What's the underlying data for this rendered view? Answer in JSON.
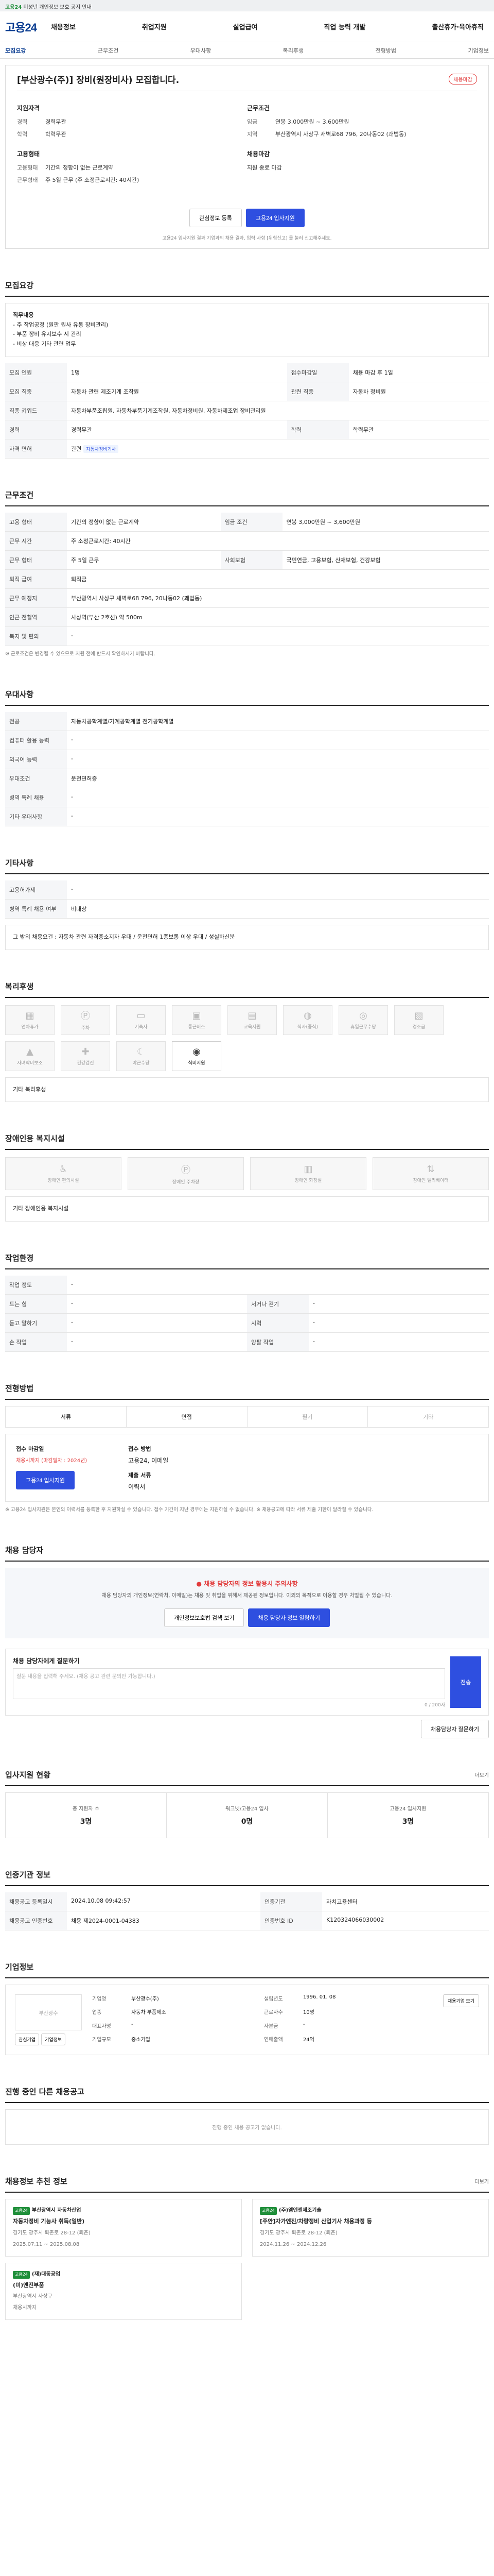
{
  "topbar": {
    "notice_prefix": "고용24",
    "notice_text": "미성년 개인정보 보호 공지 안내"
  },
  "header": {
    "logo": "고용24",
    "nav": [
      "채용정보",
      "취업지원",
      "실업급여",
      "직업 능력 개발",
      "출산휴가·육아휴직"
    ]
  },
  "subnav": {
    "items": [
      "모집요강",
      "근무조건",
      "우대사항",
      "복리후생",
      "전형방법",
      "기업정보"
    ],
    "active": 0
  },
  "job": {
    "title": "[부산광수(주)] 장비(원장비사) 모집합니다.",
    "badge": "채용마감",
    "left_title": "지원자격",
    "left": [
      {
        "k": "경력",
        "v": "경력무관"
      },
      {
        "k": "학력",
        "v": "학력무관"
      }
    ],
    "left2_title": "고용형태",
    "left2": [
      {
        "k": "고용형태",
        "v": "기간의 정함이 없는 근로계약"
      },
      {
        "k": "근무형태",
        "v": "주 5일 근무 (주 소정근로시간: 40시간)"
      }
    ],
    "right_title": "근무조건",
    "right": [
      {
        "k": "임금",
        "v": "연봉 3,000만원 ~ 3,600만원"
      },
      {
        "k": "지역",
        "v": "부산광역시 사상구 새벽로68 796, 20나동02 (괘법동)"
      }
    ],
    "right2_title": "채용마감",
    "right2": [
      {
        "k": "",
        "v": "지원 종료 마감"
      }
    ],
    "btn_save": "관심정보 등록",
    "btn_apply": "고용24 입사지원",
    "note": "고용24 입사지원 결과 기업과의 채용 결과, 입력 사항 [위험신고] 를 눌러 신고해주세요."
  },
  "recruit": {
    "title": "모집요강",
    "duty_title": "직무내용",
    "duty_lines": [
      "- 주 작업공정 (원판 원사 유통 장비관리)",
      "- 부품 장비 유지보수 시 관리",
      "- 비상 대응 기타 관련 업무"
    ],
    "rows": [
      {
        "th": "모집 인원",
        "v": "1명",
        "th2": "접수마감일",
        "v2": "채용 마감 후 1일"
      },
      {
        "th": "모집 직종",
        "v": "자동차 관련 제조기계 조작원",
        "th2": "관련 직종",
        "v2": "자동차 정비원"
      },
      {
        "th": "직종 키워드",
        "v": "자동차부품조립원, 자동차부품기계조작원, 자동차정비원, 자동차제조업 장비관리원",
        "th2": "",
        "v2": ""
      },
      {
        "th": "경력",
        "v": "경력무관",
        "th2": "학력",
        "v2": "학력무관"
      },
      {
        "th": "자격 면허",
        "v": "관련",
        "tag": "자동차정비기사",
        "th2": "",
        "v2": ""
      }
    ]
  },
  "conditions": {
    "title": "근무조건",
    "rows": [
      {
        "th": "고용 형태",
        "v": "기간의 정함이 없는 근로계약",
        "th2": "임금 조건",
        "v2": "연봉 3,000만원 ~ 3,600만원"
      },
      {
        "th": "근무 시간",
        "v": "주 소정근로시간: 40시간",
        "th2": "",
        "v2": ""
      },
      {
        "th": "근무 형태",
        "v": "주 5일 근무",
        "th2": "사회보험",
        "v2": "국민연금, 고용보험, 산재보험, 건강보험"
      },
      {
        "th": "퇴직 급여",
        "v": "퇴직금",
        "th2": "",
        "v2": ""
      },
      {
        "th": "근무 예정지",
        "v": "부산광역시 사상구 새벽로68 796, 20나동02 (괘법동)",
        "th2": "",
        "v2": ""
      },
      {
        "th": "인근 전철역",
        "v": "사상역(부산 2호선) 약 500m",
        "th2": "",
        "v2": ""
      },
      {
        "th": "복지 및 편의",
        "v": "-",
        "th2": "",
        "v2": ""
      }
    ],
    "note": "※ 근로조건은 변경될 수 있으므로 지원 전에 반드시 확인하시기 바랍니다."
  },
  "prefer": {
    "title": "우대사항",
    "rows": [
      {
        "th": "전공",
        "v": "자동차공학계열/기계공학계열 전기공학계열"
      },
      {
        "th": "컴퓨터 활용 능력",
        "v": "-"
      },
      {
        "th": "외국어 능력",
        "v": "-"
      },
      {
        "th": "우대조건",
        "v": "운전면허증"
      },
      {
        "th": "병역 특례 채용",
        "v": "-"
      },
      {
        "th": "기타 우대사항",
        "v": "-"
      }
    ]
  },
  "etc": {
    "title": "기타사항",
    "rows": [
      {
        "th": "고용허가제",
        "v": "-"
      },
      {
        "th": "병역 특례 채용 여부",
        "v": "비대상"
      }
    ],
    "extra": "그 밖의 채용요건 : 자동차 관련 자격증소지자 우대 / 운전면허 1종보통 이상 우대 / 성실하신분"
  },
  "welfare": {
    "title": "복리후생",
    "items": [
      {
        "label": "연차휴가",
        "on": false
      },
      {
        "label": "주차",
        "on": false
      },
      {
        "label": "기숙사",
        "on": false
      },
      {
        "label": "통근버스",
        "on": false
      },
      {
        "label": "교육지원",
        "on": false
      },
      {
        "label": "식사(중식)",
        "on": false
      },
      {
        "label": "휴일근무수당",
        "on": false
      },
      {
        "label": "경조금",
        "on": false
      },
      {
        "label": "자녀학비보조",
        "on": false
      },
      {
        "label": "건강검진",
        "on": false
      },
      {
        "label": "야근수당",
        "on": false
      },
      {
        "label": "식비지원",
        "on": true
      }
    ],
    "extra_label": "기타 복리후생"
  },
  "disability": {
    "title": "장애인용 복지시설",
    "items": [
      "장애인 편의시설",
      "장애인 주차장",
      "장애인 화장실",
      "장애인 엘리베이터"
    ],
    "extra_label": "기타 장애인용 복지시설"
  },
  "workenv": {
    "title": "작업환경",
    "rows": [
      {
        "th": "작업 정도",
        "v": "-",
        "th2": "",
        "v2": ""
      },
      {
        "th": "드는 힘",
        "v": "-",
        "th2": "서거나 걷기",
        "v2": "-"
      },
      {
        "th": "듣고 말하기",
        "v": "-",
        "th2": "시력",
        "v2": "-"
      },
      {
        "th": "손 작업",
        "v": "-",
        "th2": "양팔 작업",
        "v2": "-"
      }
    ]
  },
  "process": {
    "title": "전형방법",
    "steps": [
      {
        "label": "서류",
        "on": true
      },
      {
        "label": "면접",
        "on": true
      },
      {
        "label": "필기",
        "on": false
      },
      {
        "label": "기타",
        "on": false
      }
    ],
    "apply_title": "접수 마감일",
    "apply_date": "채용시까지 (마감일자 : 2024년)",
    "method_title": "접수 방법",
    "method_v": "고용24, 이메일",
    "submit_title": "제출 서류",
    "submit_v": "이력서",
    "apply_btn": "고용24 입사지원",
    "notes": "※ 고용24 입사지원은 본인의 이력서를 등록한 후 지원하실 수 있습니다. 접수 기간이 지난 경우에는 지원하실 수 없습니다. ※ 채용공고에 따라 서류 제출 기한이 달라질 수 있습니다."
  },
  "contact": {
    "title": "채용 담당자",
    "warn_title": "채용 담당자의 정보 활용시 주의사항",
    "warn_text": "채용 담당자의 개인정보(연락처, 이메일)는 채용 및 취업을 위해서 제공된 정보입니다. 이외의 목적으로 이용할 경우 처벌될 수 있습니다.",
    "btn_confirm": "개인정보보호법 검색 보기",
    "btn_view": "채용 담당자 정보 열람하기",
    "ask_title": "채용 담당자에게 질문하기",
    "ask_placeholder": "질문 내용을 입력해 주세요. (채용 공고 관련 문의만 가능합니다.)",
    "ask_count": "0 / 200자",
    "ask_send": "전송",
    "ask_btn2": "채용담당자 질문하기"
  },
  "stats": {
    "title": "입사지원 현황",
    "more": "더보기",
    "items": [
      {
        "label": "총 지원자 수",
        "value": "3명"
      },
      {
        "label": "워크넷/고용24 입사",
        "value": "0명"
      },
      {
        "label": "고용24 입사지원",
        "value": "3명"
      }
    ]
  },
  "org": {
    "title": "인증기관 정보",
    "rows": [
      {
        "th": "채용공고 등록일시",
        "v": "2024.10.08 09:42:57",
        "th2": "인증기관",
        "v2": "자치고용센터"
      },
      {
        "th": "채용공고 인증번호",
        "v": "채용 제2024-0001-04383",
        "th2": "인증번호 ID",
        "v2": "K120324066030002"
      }
    ]
  },
  "company": {
    "title": "기업정보",
    "logo_text": "부산광수",
    "info": [
      {
        "k": "기업명",
        "v": "부산광수(주)"
      },
      {
        "k": "설립년도",
        "v": "1996. 01. 08"
      },
      {
        "k": "업종",
        "v": "자동차 부품제조"
      },
      {
        "k": "근로자수",
        "v": "10명"
      },
      {
        "k": "대표자명",
        "v": "-"
      },
      {
        "k": "자본금",
        "v": "-"
      },
      {
        "k": "기업규모",
        "v": "중소기업"
      },
      {
        "k": "연매출액",
        "v": "24억"
      }
    ],
    "btn_a": "관심기업",
    "btn_b": "기업정보",
    "btn_c": "채용기업 보기"
  },
  "other_jobs": {
    "title": "진행 중인 다른 채용공고",
    "empty": "진행 중인 채용 공고가 없습니다."
  },
  "recommend": {
    "title": "채용정보 추천 정보",
    "more": "더보기",
    "jobs": [
      {
        "tag": "고용24",
        "co": "부산광역시 자동차산업",
        "title": "자동차정비 기능사 취득(일반)",
        "loc": "경기도 광주시 퇴촌로 28-12 (퇴촌)",
        "date": "2025.07.11 ~ 2025.08.08"
      },
      {
        "tag": "고용24",
        "co": "(주)엠엔젠제조기술",
        "title": "[주안]자가엔진/차량정비 산업기사 채용과정 등",
        "loc": "경기도 광주시 퇴촌로 28-12 (퇴촌)",
        "date": "2024.11.26 ~ 2024.12.26"
      },
      {
        "tag": "고용24",
        "co": "(재)대동공업",
        "title": "(미)엔진부품",
        "loc": "부산광역시 사상구",
        "date": "채용시까지"
      }
    ]
  }
}
